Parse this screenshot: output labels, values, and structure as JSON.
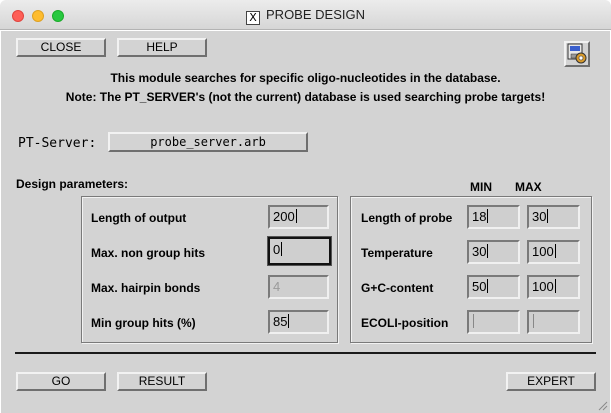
{
  "window": {
    "title": "PROBE DESIGN",
    "title_icon": "X"
  },
  "toolbar": {
    "close_label": "CLOSE",
    "help_label": "HELP",
    "prefs_icon": "config-icon"
  },
  "intro": {
    "line1": "This module searches for specific oligo-nucleotides in the database.",
    "line2": "Note: The PT_SERVER's (not the current) database is used searching probe targets!"
  },
  "pt_server": {
    "label": "PT-Server:",
    "value": "probe_server.arb"
  },
  "design": {
    "heading": "Design parameters:",
    "min_header": "MIN",
    "max_header": "MAX",
    "left": [
      {
        "label": "Length of output",
        "value": "200",
        "disabled": false,
        "focused": false
      },
      {
        "label": "Max. non group hits",
        "value": "0",
        "disabled": false,
        "focused": true
      },
      {
        "label": "Max. hairpin bonds",
        "value": "4",
        "disabled": true,
        "focused": false
      },
      {
        "label": "Min group hits (%)",
        "value": "85",
        "disabled": false,
        "focused": false
      }
    ],
    "right": [
      {
        "label": "Length of probe",
        "min": "18",
        "max": "30"
      },
      {
        "label": "Temperature",
        "min": "30",
        "max": "100"
      },
      {
        "label": "G+C-content",
        "min": "50",
        "max": "100"
      },
      {
        "label": "ECOLI-position",
        "min": "",
        "max": ""
      }
    ]
  },
  "footer": {
    "go_label": "GO",
    "result_label": "RESULT",
    "expert_label": "EXPERT"
  }
}
